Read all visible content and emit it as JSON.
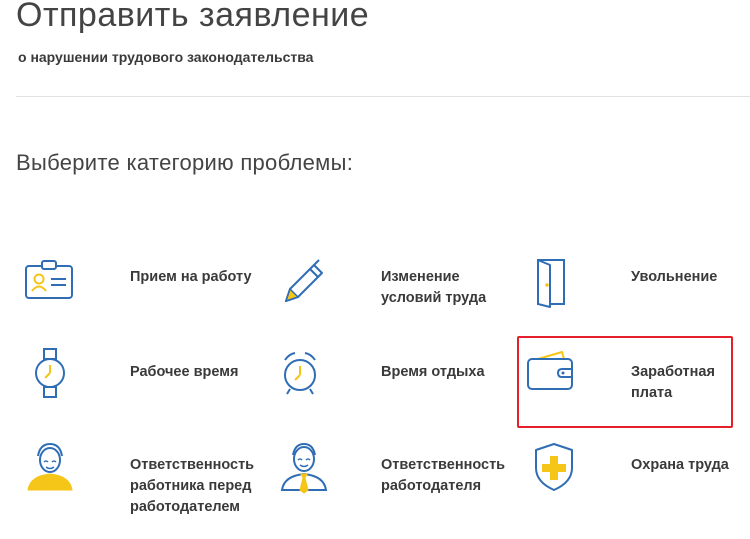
{
  "header": {
    "title": "Отправить заявление",
    "subtitle": "о нарушении трудового законодательства"
  },
  "section": {
    "heading": "Выберите категорию проблемы:"
  },
  "colors": {
    "icon_blue": "#2f6db5",
    "icon_yellow": "#f5c518",
    "highlight_red": "#e3202b"
  },
  "categories": [
    {
      "label": "Прием на работу",
      "icon": "id-badge-icon"
    },
    {
      "label": "Изменение\nусловий труда",
      "icon": "pen-icon"
    },
    {
      "label": "Увольнение",
      "icon": "door-icon"
    },
    {
      "label": "Рабочее время",
      "icon": "wristwatch-icon"
    },
    {
      "label": "Время отдыха",
      "icon": "alarm-clock-icon"
    },
    {
      "label": "Заработная\nплата",
      "icon": "wallet-icon",
      "highlighted": true
    },
    {
      "label": "Ответственность\nработника перед\nработодателем",
      "icon": "worker-icon"
    },
    {
      "label": "Ответственность\nработодателя",
      "icon": "employer-icon"
    },
    {
      "label": "Охрана труда",
      "icon": "shield-cross-icon"
    }
  ]
}
